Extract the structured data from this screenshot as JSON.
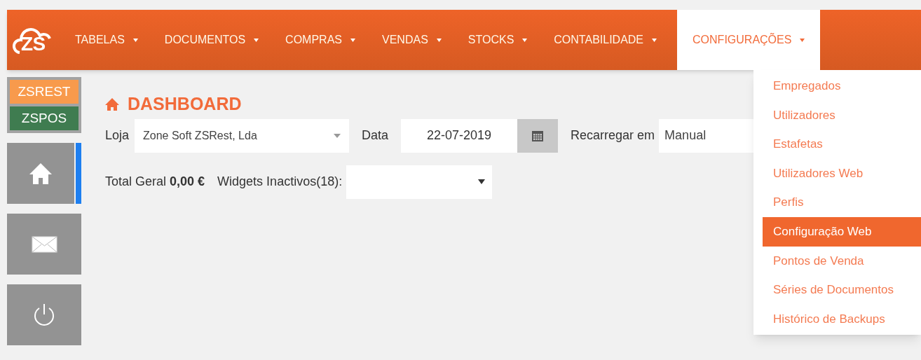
{
  "nav": {
    "logo": "ZS",
    "items": [
      {
        "label": "TABELAS",
        "selected": false
      },
      {
        "label": "DOCUMENTOS",
        "selected": false
      },
      {
        "label": "COMPRAS",
        "selected": false
      },
      {
        "label": "VENDAS",
        "selected": false
      },
      {
        "label": "STOCKS",
        "selected": false
      },
      {
        "label": "CONTABILIDADE",
        "selected": false
      },
      {
        "label": "CONFIGURAÇÕES",
        "selected": true
      }
    ],
    "dropdown": [
      {
        "label": "Empregados",
        "selected": false
      },
      {
        "label": "Utilizadores",
        "selected": false
      },
      {
        "label": "Estafetas",
        "selected": false
      },
      {
        "label": "Utilizadores Web",
        "selected": false
      },
      {
        "label": "Perfis",
        "selected": false
      },
      {
        "label": "Configuração Web",
        "selected": true
      },
      {
        "label": "Pontos de Venda",
        "selected": false
      },
      {
        "label": "Séries de Documentos",
        "selected": false
      },
      {
        "label": "Histórico de Backups",
        "selected": false
      }
    ]
  },
  "sidebar": {
    "apps": [
      "ZSREST",
      "ZSPOS"
    ],
    "tiles": [
      {
        "kind": "home",
        "selected": true
      },
      {
        "kind": "mail",
        "selected": false
      },
      {
        "kind": "power",
        "selected": false
      }
    ]
  },
  "dashboard": {
    "title": "DASHBOARD",
    "loja_label": "Loja",
    "loja_value": "Zone Soft ZSRest, Lda",
    "data_label": "Data",
    "data_value": "22-07-2019",
    "reload_label": "Recarregar em",
    "reload_value": "Manual",
    "total": "Total Geral **0,00 €**",
    "widgets_label": "Widgets Inactivos(18):"
  }
}
